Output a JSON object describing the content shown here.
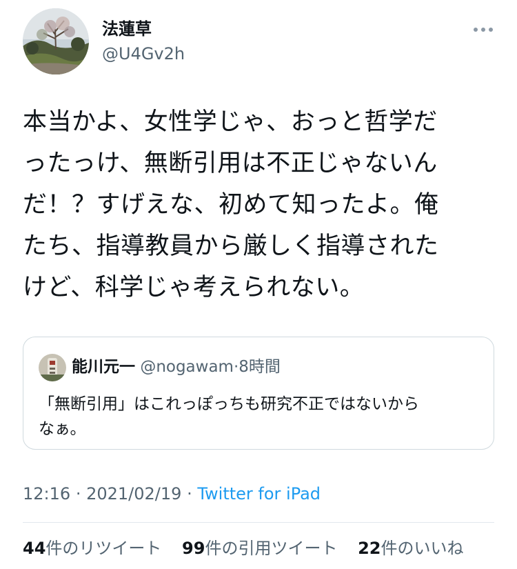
{
  "author": {
    "display_name": "法蓮草",
    "handle": "@U4Gv2h",
    "avatar_icon": "profile-photo-garden"
  },
  "more_icon": "more-options-icon",
  "tweet": {
    "text": "本当かよ、女性学じゃ、おっと哲学だ\nったっけ、無断引用は不正じゃないん\nだ！？すげえな、初めて知ったよ。俺\nたち、指導教員から厳しく指導された\nけど、科学じゃ考えられない。"
  },
  "quote": {
    "display_name": "能川元一",
    "handle": "@nogawam",
    "separator": "·",
    "time": "8時間",
    "text": "「無断引用」はこれっぽっちも研究不正ではないから\nなぁ。"
  },
  "meta": {
    "time": "12:16",
    "sep1": "·",
    "date": "2021/02/19",
    "sep2": "·",
    "source": "Twitter for iPad"
  },
  "stats": {
    "retweets_count": "44",
    "retweets_label": "件のリツイート",
    "quotes_count": "99",
    "quotes_label": "件の引用ツイート",
    "likes_count": "22",
    "likes_label": "件のいいね"
  },
  "colors": {
    "text": "#0f1419",
    "secondary": "#536471",
    "link": "#1d9bf0",
    "border": "#cfd9de"
  }
}
